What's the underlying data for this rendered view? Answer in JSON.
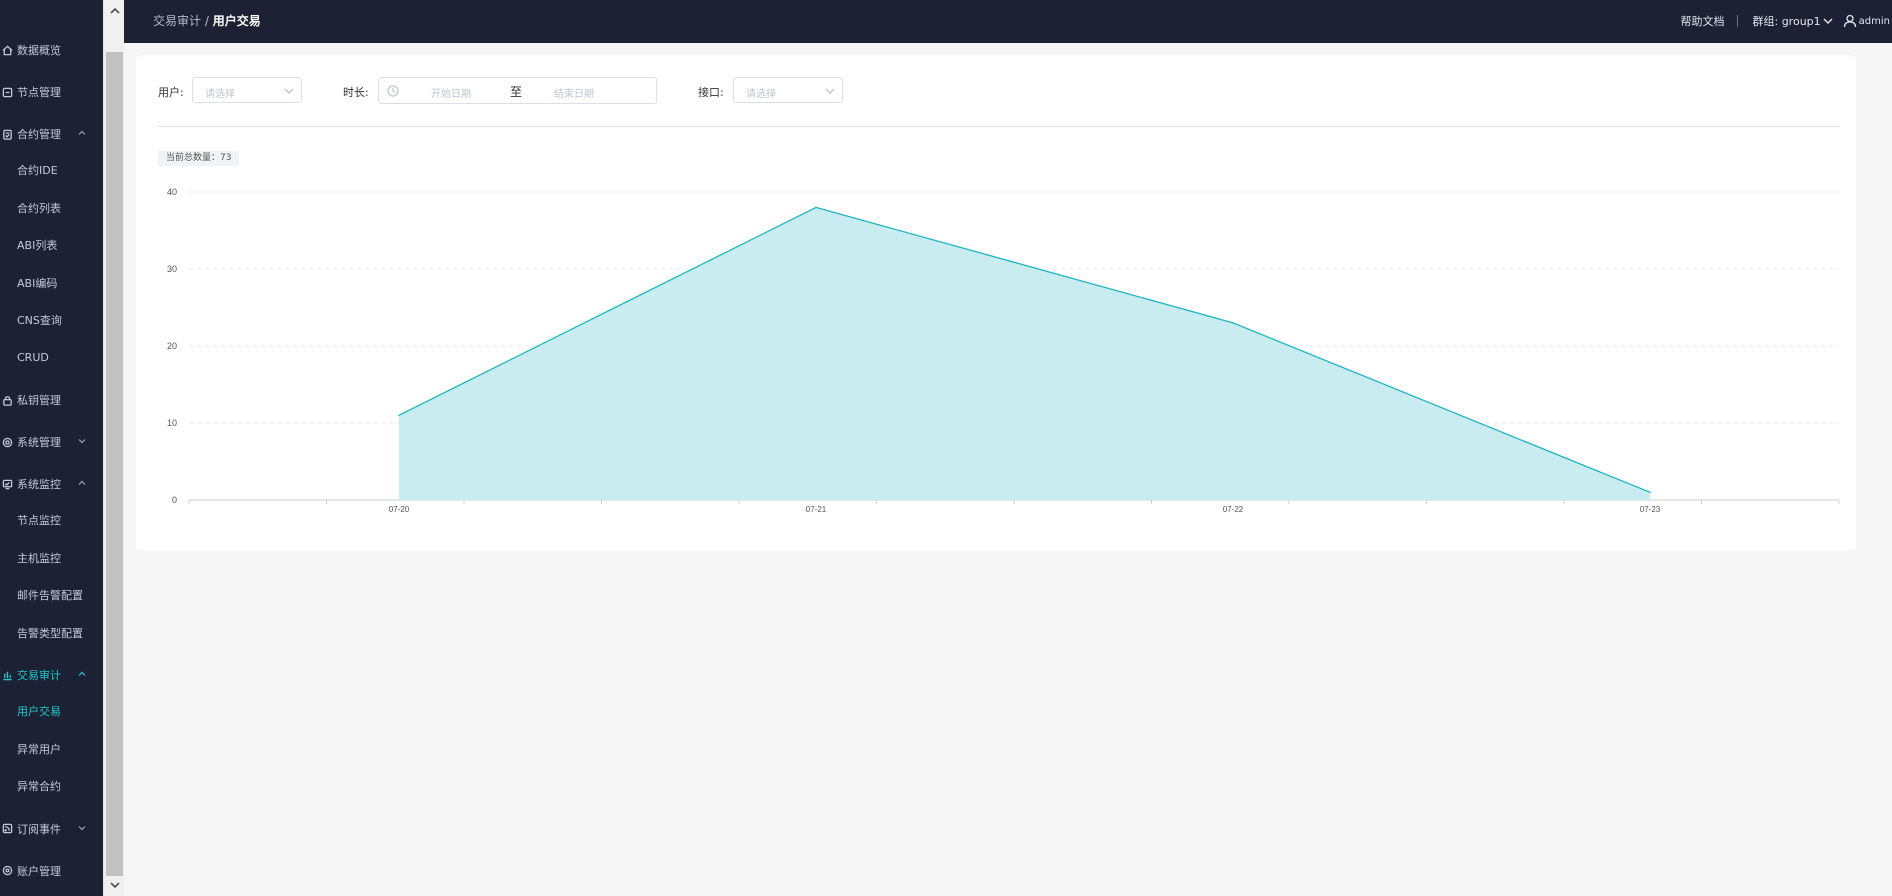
{
  "sidebar": {
    "items": [
      {
        "label": "数据概览",
        "icon": "home-icon",
        "expandable": false,
        "expanded": false,
        "active": false,
        "children": []
      },
      {
        "label": "节点管理",
        "icon": "node-icon",
        "expandable": false,
        "expanded": false,
        "active": false,
        "children": []
      },
      {
        "label": "合约管理",
        "icon": "contract-icon",
        "expandable": true,
        "expanded": true,
        "active": false,
        "children": [
          {
            "label": "合约IDE"
          },
          {
            "label": "合约列表"
          },
          {
            "label": "ABI列表"
          },
          {
            "label": "ABI编码"
          },
          {
            "label": "CNS查询"
          },
          {
            "label": "CRUD"
          }
        ]
      },
      {
        "label": "私钥管理",
        "icon": "lock-icon",
        "expandable": false,
        "expanded": false,
        "active": false,
        "children": []
      },
      {
        "label": "系统管理",
        "icon": "settings-icon",
        "expandable": true,
        "expanded": false,
        "active": false,
        "children": []
      },
      {
        "label": "系统监控",
        "icon": "monitor-icon",
        "expandable": true,
        "expanded": true,
        "active": false,
        "children": [
          {
            "label": "节点监控"
          },
          {
            "label": "主机监控"
          },
          {
            "label": "邮件告警配置"
          },
          {
            "label": "告警类型配置"
          }
        ]
      },
      {
        "label": "交易审计",
        "icon": "bar-chart-icon",
        "expandable": true,
        "expanded": true,
        "active": true,
        "children": [
          {
            "label": "用户交易",
            "active": true
          },
          {
            "label": "异常用户"
          },
          {
            "label": "异常合约"
          }
        ]
      },
      {
        "label": "订阅事件",
        "icon": "rss-icon",
        "expandable": true,
        "expanded": false,
        "active": false,
        "children": []
      },
      {
        "label": "账户管理",
        "icon": "account-icon",
        "expandable": false,
        "expanded": false,
        "active": false,
        "children": []
      }
    ]
  },
  "header": {
    "breadcrumb_parent": "交易审计",
    "breadcrumb_sep": "/",
    "breadcrumb_current": "用户交易",
    "help_label": "帮助文档",
    "group_label": "群组: group1",
    "user_label": "admin"
  },
  "filters": {
    "user_label": "用户:",
    "user_placeholder": "请选择",
    "duration_label": "时长:",
    "start_placeholder": "开始日期",
    "range_separator": "至",
    "end_placeholder": "结束日期",
    "interface_label": "接口:",
    "interface_placeholder": "请选择"
  },
  "total_label": "当前总数量：73",
  "colors": {
    "accent": "#1ec8cf",
    "sidebar_bg": "#1c2233",
    "area_fill": "#c9ecf0",
    "line": "#1eb4c4"
  },
  "chart_data": {
    "type": "area",
    "categories": [
      "07-20",
      "07-21",
      "07-22",
      "07-23"
    ],
    "values": [
      11,
      38,
      23,
      1
    ],
    "ylim": [
      0,
      40
    ],
    "yticks": [
      0,
      10,
      20,
      30,
      40
    ],
    "title": "",
    "xlabel": "",
    "ylabel": "",
    "grid": true
  }
}
